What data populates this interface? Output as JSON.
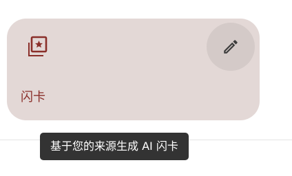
{
  "card": {
    "label": "闪卡",
    "icon": "flashcards-icon",
    "edit_icon": "pencil-icon",
    "background": "#e3d8d6",
    "accent": "#8a2f2a"
  },
  "tooltip": {
    "text": "基于您的来源生成 AI 闪卡"
  }
}
